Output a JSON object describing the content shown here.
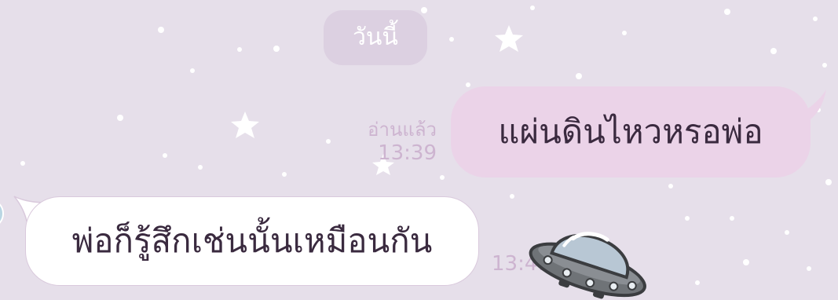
{
  "chat": {
    "date_separator": "วันนี้",
    "messages": [
      {
        "direction": "outgoing",
        "text": "แผ่นดินไหวหรอพ่อ",
        "read_status": "อ่านแล้ว",
        "time": "13:39"
      },
      {
        "direction": "incoming",
        "text": "พ่อก็รู้สึกเช่นนั้นเหมือนกัน",
        "time": "13:41",
        "sticker": "ufo-sticker-icon"
      }
    ]
  },
  "theme": {
    "background": "#e6dfea",
    "outgoing_bubble": "#ebd3e8",
    "incoming_bubble": "#ffffff",
    "meta_text": "#cdb4d0",
    "date_chip": "#dcd0e1"
  }
}
